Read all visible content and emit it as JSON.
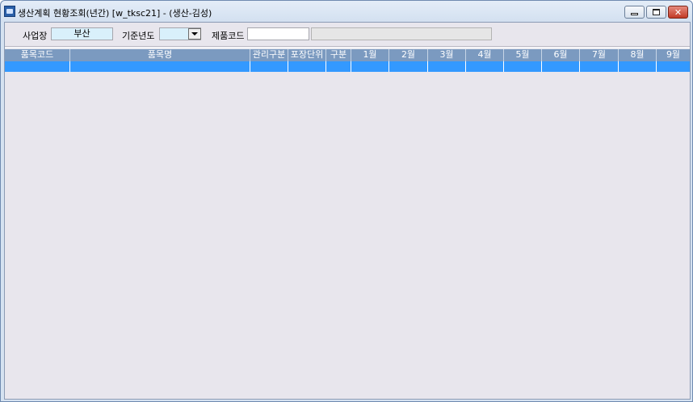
{
  "window": {
    "title": "생산계획 현황조회(년간) [w_tksc21] - (생산-김성)"
  },
  "filters": {
    "site_label": "사업장",
    "site_value": "부산",
    "year_label": "기준년도",
    "year_value": "",
    "product_code_label": "제품코드",
    "product_code_value": "",
    "product_name_value": ""
  },
  "grid": {
    "columns": [
      "품목코드",
      "품목명",
      "관리구분",
      "포장단위",
      "구분",
      "1월",
      "2월",
      "3월",
      "4월",
      "5월",
      "6월",
      "7월",
      "8월",
      "9월"
    ],
    "rows": [
      [
        "",
        "",
        "",
        "",
        "",
        "",
        "",
        "",
        "",
        "",
        "",
        "",
        "",
        ""
      ]
    ],
    "selected_row_color": "#3399ff",
    "header_color": "#7b9ac0"
  }
}
